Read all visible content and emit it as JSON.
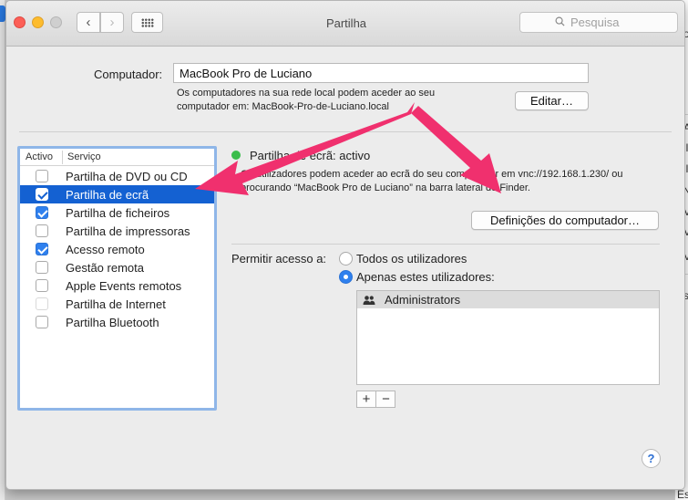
{
  "window": {
    "title": "Partilha"
  },
  "toolbar": {
    "back_icon": "chevron-left-icon",
    "forward_icon": "chevron-right-icon",
    "grid_icon": "grid-icon",
    "search_placeholder": "Pesquisa"
  },
  "computer": {
    "label": "Computador:",
    "name": "MacBook Pro de Luciano",
    "info": "Os computadores na sua rede local podem aceder ao seu computador em: MacBook-Pro-de-Luciano.local",
    "edit_label": "Editar…"
  },
  "services": {
    "header_active": "Activo",
    "header_service": "Serviço",
    "items": [
      {
        "label": "Partilha de DVD ou CD",
        "checked": false,
        "selected": false,
        "disabled": false
      },
      {
        "label": "Partilha de ecrã",
        "checked": true,
        "selected": true,
        "disabled": false
      },
      {
        "label": "Partilha de ficheiros",
        "checked": true,
        "selected": false,
        "disabled": false
      },
      {
        "label": "Partilha de impressoras",
        "checked": false,
        "selected": false,
        "disabled": false
      },
      {
        "label": "Acesso remoto",
        "checked": true,
        "selected": false,
        "disabled": false
      },
      {
        "label": "Gestão remota",
        "checked": false,
        "selected": false,
        "disabled": false
      },
      {
        "label": "Apple Events remotos",
        "checked": false,
        "selected": false,
        "disabled": false
      },
      {
        "label": "Partilha de Internet",
        "checked": false,
        "selected": false,
        "disabled": true
      },
      {
        "label": "Partilha Bluetooth",
        "checked": false,
        "selected": false,
        "disabled": false
      }
    ]
  },
  "detail": {
    "status": "Partilha de ecrã: activo",
    "status_color": "#3bbd4b",
    "description": "Os utilizadores podem aceder ao ecrã do seu computador em vnc://192.168.1.230/ ou procurando “MacBook Pro de Luciano” na barra lateral do Finder.",
    "settings_label": "Definições do computador…",
    "access_label": "Permitir acesso a:",
    "option_all": "Todos os utilizadores",
    "option_only": "Apenas estes utilizadores:",
    "users": [
      "Administrators"
    ],
    "add_label": "+",
    "remove_label": "−",
    "help_label": "?"
  },
  "background": {
    "right_fragments": [
      "o",
      "A",
      "il",
      "il",
      "N",
      "V",
      "V",
      "V",
      "scl",
      "Escolha"
    ]
  },
  "colors": {
    "selection": "#1461d2",
    "checkbox": "#2f80ee",
    "annotation_arrow": "#f0306e"
  }
}
